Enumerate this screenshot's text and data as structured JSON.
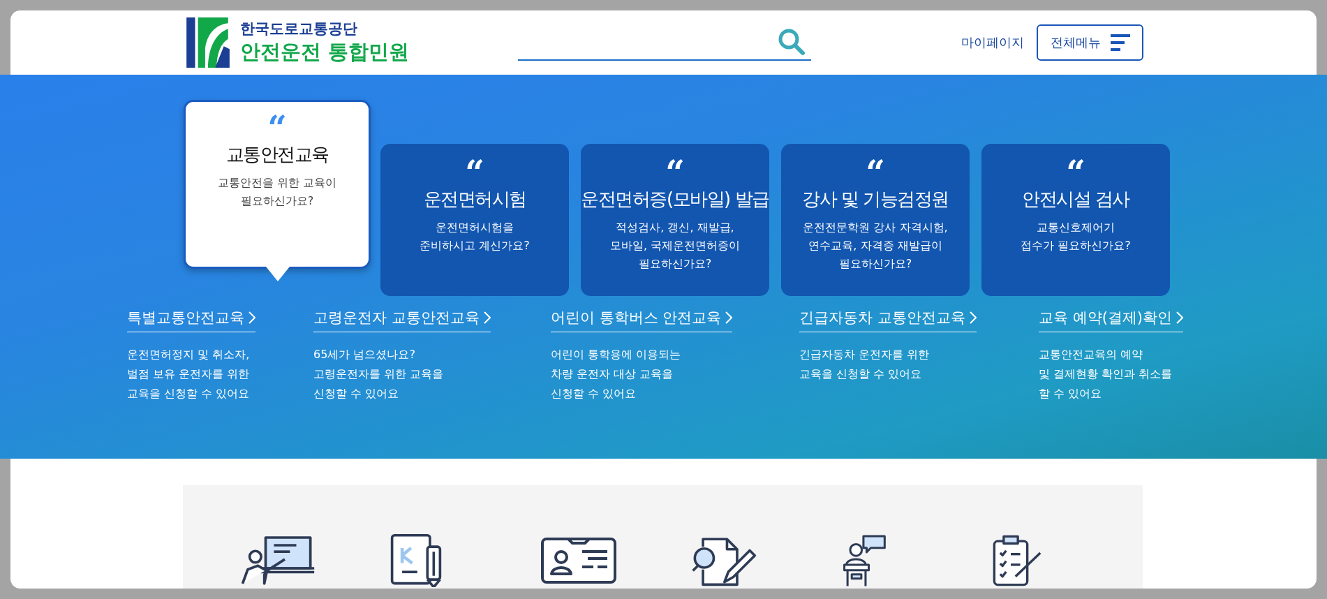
{
  "header": {
    "logo_top": "한국도로교통공단",
    "logo_bottom": "안전운전 통합민원",
    "mypage": "마이페이지",
    "menu_button": "전체메뉴"
  },
  "cards": [
    {
      "quote": "“",
      "title": "교통안전교육",
      "desc": "교통안전을 위한 교육이\n필요하신가요?",
      "selected": true
    },
    {
      "quote": "“",
      "title": "운전면허시험",
      "desc": "운전면허시험을\n준비하시고 계신가요?",
      "selected": false
    },
    {
      "quote": "“",
      "title": "운전면허증(모바일) 발급",
      "desc": "적성검사, 갱신, 재발급,\n모바일, 국제운전면허증이\n필요하신가요?",
      "selected": false
    },
    {
      "quote": "“",
      "title": "강사 및 기능검정원",
      "desc": "운전전문학원 강사 자격시험,\n연수교육, 자격증 재발급이\n필요하신가요?",
      "selected": false
    },
    {
      "quote": "“",
      "title": "안전시설 검사",
      "desc": "교통신호제어기\n접수가 필요하신가요?",
      "selected": false
    }
  ],
  "links": [
    {
      "title": "특별교통안전교육",
      "desc": "운전면허정지 및 취소자,\n벌점 보유 운전자를 위한\n교육을 신청할 수 있어요"
    },
    {
      "title": "고령운전자 교통안전교육",
      "desc": "65세가 넘으셨나요?\n고령운전자를 위한 교육을\n신청할 수 있어요"
    },
    {
      "title": "어린이 통학버스 안전교육",
      "desc": "어린이 통학용에 이용되는\n차량 운전자 대상 교육을\n신청할 수 있어요"
    },
    {
      "title": "긴급자동차 교통안전교육",
      "desc": "긴급자동차 운전자를 위한\n교육을 신청할 수 있어요"
    },
    {
      "title": "교육 예약(결제)확인",
      "desc": "교통안전교육의 예약\n및 결제현황 확인과 취소를\n할 수 있어요"
    }
  ],
  "services": [
    {
      "kind": "lecture"
    },
    {
      "kind": "document"
    },
    {
      "kind": "idcard"
    },
    {
      "kind": "inspect"
    },
    {
      "kind": "speaker"
    },
    {
      "kind": "checklist"
    }
  ]
}
